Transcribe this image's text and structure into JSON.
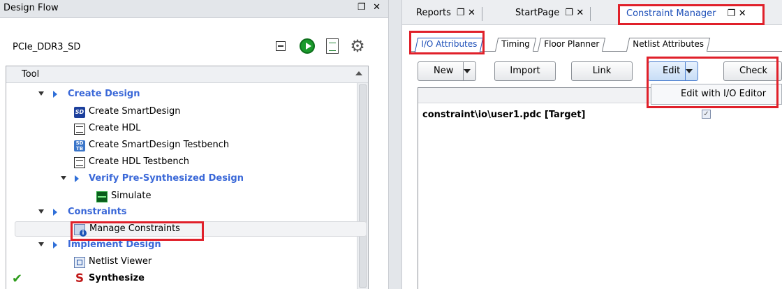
{
  "design_flow": {
    "title": "Design Flow",
    "window_controls": "❐ ✕",
    "project_name": "PCIe_DDR3_SD",
    "tree_header": "Tool",
    "items": [
      {
        "label": "Create Design",
        "type": "category",
        "expanded": true
      },
      {
        "label": "Create SmartDesign",
        "type": "item"
      },
      {
        "label": "Create HDL",
        "type": "item"
      },
      {
        "label": "Create SmartDesign Testbench",
        "type": "item"
      },
      {
        "label": "Create HDL Testbench",
        "type": "item"
      },
      {
        "label": "Verify Pre-Synthesized Design",
        "type": "category",
        "expanded": true
      },
      {
        "label": "Simulate",
        "type": "item"
      },
      {
        "label": "Constraints",
        "type": "category",
        "expanded": true
      },
      {
        "label": "Manage Constraints",
        "type": "item",
        "selected": true,
        "highlighted": true
      },
      {
        "label": "Implement Design",
        "type": "category",
        "expanded": true
      },
      {
        "label": "Netlist Viewer",
        "type": "item"
      },
      {
        "label": "Synthesize",
        "type": "item",
        "completed": true
      }
    ],
    "icons": {
      "collapse": "collapse-all-icon",
      "run": "run-icon",
      "report": "report-icon",
      "options": "tool-options-icon"
    }
  },
  "doc_tabs": [
    {
      "label": "Reports",
      "controls": "❐ ✕"
    },
    {
      "label": "StartPage",
      "controls": "❐ ✕"
    },
    {
      "label": "Constraint Manager",
      "controls": "❐ ✕",
      "active": true,
      "highlighted": true
    }
  ],
  "constraint_manager": {
    "tabs": [
      {
        "label": "I/O Attributes",
        "active": true,
        "highlighted": true
      },
      {
        "label": "Timing"
      },
      {
        "label": "Floor Planner"
      },
      {
        "label": "Netlist Attributes"
      }
    ],
    "buttons": {
      "new": "New",
      "import": "Import",
      "link": "Link",
      "edit": "Edit",
      "check": "Check"
    },
    "edit_menu": {
      "item": "Edit with I/O Editor"
    },
    "files": [
      {
        "name": "constraint\\io\\user1.pdc  [Target]",
        "checked": true
      }
    ]
  },
  "colors": {
    "highlight": "#e0202a",
    "category_text": "#3a68d8",
    "active_tab_text": "#1d4fb8",
    "check": "#2f9d1d"
  }
}
